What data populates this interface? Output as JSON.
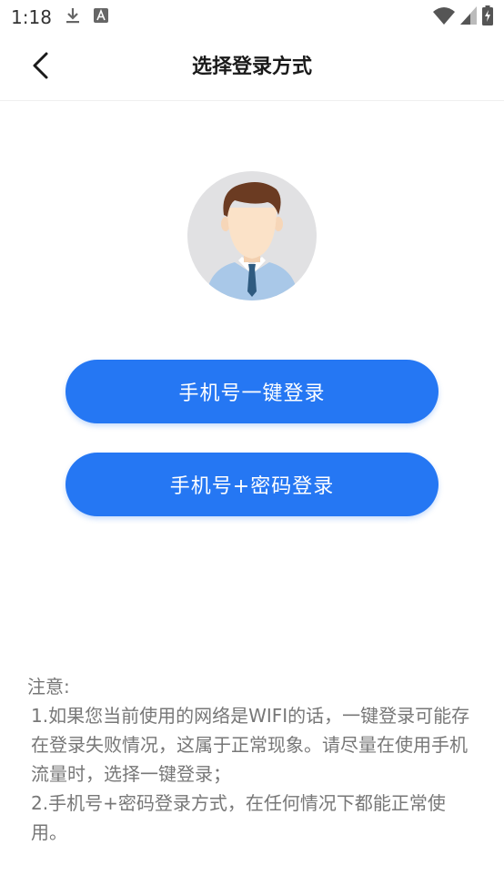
{
  "status_bar": {
    "time": "1:18",
    "icons": [
      "download-icon",
      "a-notification-icon",
      "wifi-icon",
      "signal-icon",
      "battery-icon"
    ]
  },
  "header": {
    "back_icon": "chevron-left-icon",
    "title": "选择登录方式"
  },
  "avatar": {
    "icon": "user-avatar-icon"
  },
  "buttons": {
    "one_key_login": "手机号一键登录",
    "password_login": "手机号+密码登录"
  },
  "notice": {
    "heading": "注意:",
    "items": [
      "1.如果您当前使用的网络是WIFI的话，一键登录可能存在登录失败情况，这属于正常现象。请尽量在使用手机流量时，选择一键登录；",
      "2.手机号+密码登录方式，在任何情况下都能正常使用。"
    ]
  },
  "colors": {
    "primary": "#2577f3",
    "avatar_bg": "#e1e1e3",
    "notice_text": "#777777"
  }
}
